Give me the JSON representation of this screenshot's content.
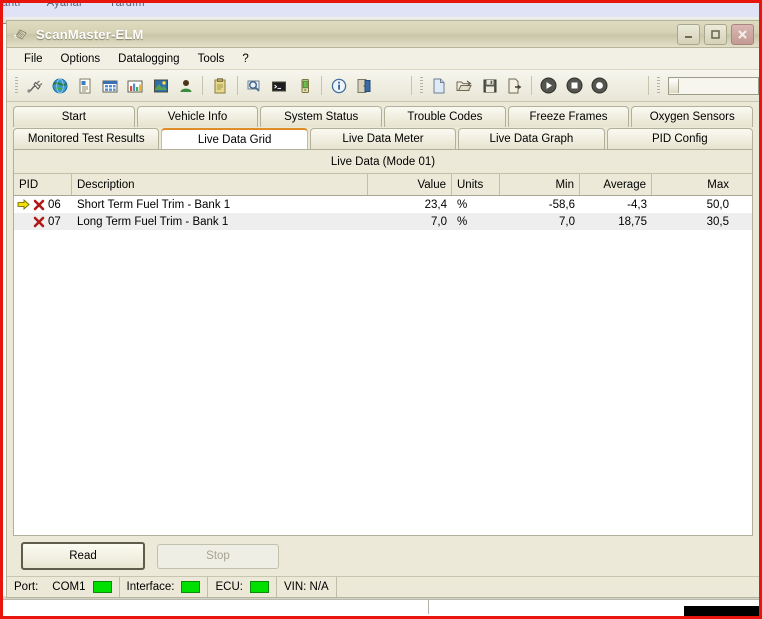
{
  "background_window": {
    "menu_items": [
      "lantı",
      "Ayarlar",
      "Yardım"
    ]
  },
  "window": {
    "title": "ScanMaster-ELM",
    "icon": "chip-icon",
    "controls": {
      "minimize": "minimize-icon",
      "maximize": "maximize-icon",
      "close": "close-icon"
    }
  },
  "menubar": {
    "items": [
      "File",
      "Options",
      "Datalogging",
      "Tools",
      "?"
    ]
  },
  "toolbar": {
    "group1": [
      "connector-icon",
      "globe-icon",
      "document-icon",
      "grid-icon",
      "bar-chart-icon",
      "image-icon",
      "user-icon"
    ],
    "group2": [
      "clipboard-icon"
    ],
    "group3": [
      "search-icon",
      "terminal-icon",
      "device-icon"
    ],
    "group4": [
      "info-icon",
      "exit-icon"
    ],
    "group5": [
      "new-file-icon",
      "open-folder-icon",
      "save-icon",
      "export-icon"
    ],
    "group6": [
      "play-icon",
      "stop-icon",
      "record-icon"
    ],
    "progress_value": ""
  },
  "tabs": {
    "row1": [
      {
        "label": "Start",
        "active": false
      },
      {
        "label": "Vehicle Info",
        "active": false
      },
      {
        "label": "System Status",
        "active": false
      },
      {
        "label": "Trouble Codes",
        "active": false
      },
      {
        "label": "Freeze Frames",
        "active": false
      },
      {
        "label": "Oxygen Sensors",
        "active": false
      }
    ],
    "row2": [
      {
        "label": "Monitored Test Results",
        "active": false
      },
      {
        "label": "Live Data Grid",
        "active": true
      },
      {
        "label": "Live Data Meter",
        "active": false
      },
      {
        "label": "Live Data Graph",
        "active": false
      },
      {
        "label": "PID Config",
        "active": false
      }
    ]
  },
  "grid": {
    "title": "Live Data (Mode 01)",
    "columns": [
      "PID",
      "Description",
      "Value",
      "Units",
      "Min",
      "Average",
      "Max"
    ],
    "rows": [
      {
        "selected": true,
        "marker": "x-mark-icon",
        "pid": "06",
        "description": "Short Term Fuel Trim - Bank 1",
        "value": "23,4",
        "units": "%",
        "min": "-58,6",
        "average": "-4,3",
        "max": "50,0"
      },
      {
        "selected": false,
        "marker": "x-mark-icon",
        "pid": "07",
        "description": "Long Term Fuel Trim - Bank 1",
        "value": "7,0",
        "units": "%",
        "min": "7,0",
        "average": "18,75",
        "max": "30,5"
      }
    ]
  },
  "buttons": {
    "read": "Read",
    "stop": "Stop"
  },
  "statusbar": {
    "port_label": "Port:",
    "port_value": "COM1",
    "interface_label": "Interface:",
    "ecu_label": "ECU:",
    "vin": "VIN: N/A"
  },
  "colors": {
    "accent_tab": "#e08c29",
    "window_border": "#e8150f",
    "led_green": "#00e000",
    "chrome": "#ece9d8",
    "marker_red": "#b01818",
    "arrow_yellow": "#f2e200"
  }
}
